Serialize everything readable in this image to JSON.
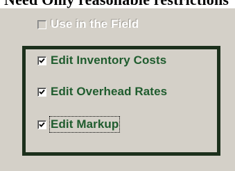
{
  "header_fragment": "Need Only reasonable restrictions",
  "options": {
    "use_in_field": {
      "label": "Use in the Field",
      "checked": false,
      "enabled": false
    },
    "edit_inventory_costs": {
      "label": "Edit Inventory Costs",
      "checked": true,
      "enabled": true
    },
    "edit_overhead_rates": {
      "label": "Edit Overhead Rates",
      "checked": true,
      "enabled": true
    },
    "edit_markup": {
      "label": "Edit Markup",
      "checked": true,
      "enabled": true,
      "focused": true
    }
  },
  "colors": {
    "panel_bg": "#d4d0c8",
    "label_text": "#1f5c2e",
    "frame_border": "#1c301c",
    "disabled_text": "#ffffff"
  }
}
